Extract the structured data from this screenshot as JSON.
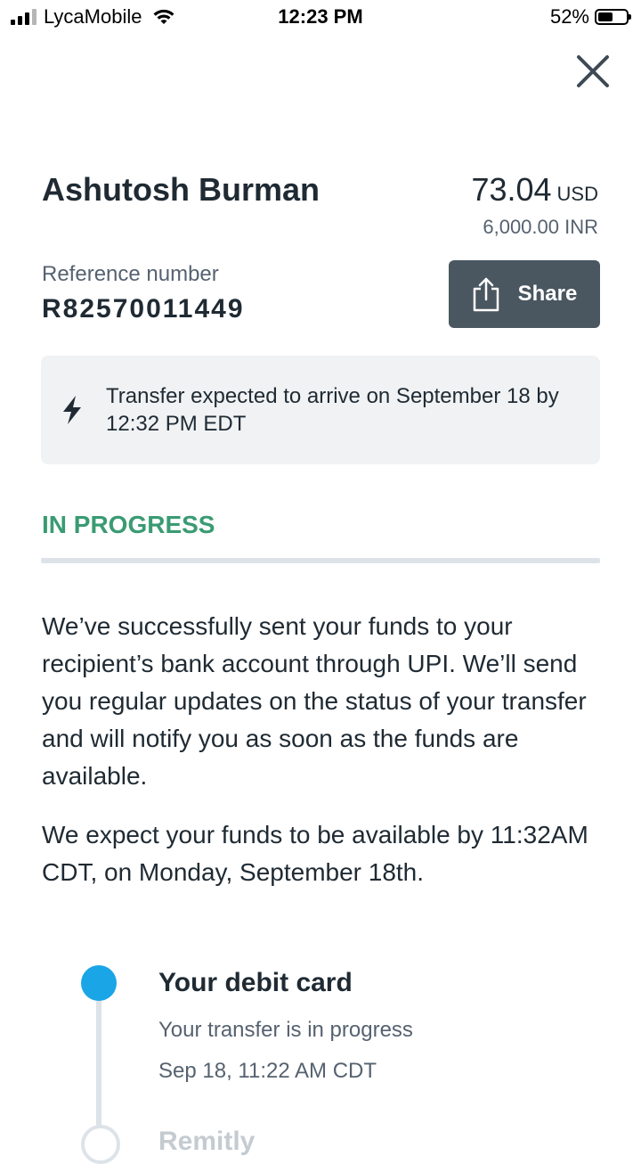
{
  "status_bar": {
    "carrier": "LycaMobile",
    "time": "12:23 PM",
    "battery": "52%",
    "battery_level": 0.52
  },
  "header": {
    "close_icon": "close-icon"
  },
  "transfer": {
    "recipient": "Ashutosh Burman",
    "amount": "73.04",
    "currency": "USD",
    "converted": "6,000.00 INR",
    "reference_label": "Reference number",
    "reference_number": "R82570011449",
    "share_label": "Share"
  },
  "eta": {
    "icon": "lightning-icon",
    "text": "Transfer expected to arrive on September 18 by 12:32 PM EDT"
  },
  "status": {
    "title": "IN PROGRESS",
    "color": "#3a9b73",
    "paragraph1": "We’ve successfully sent your funds to your recipient’s bank account through UPI. We’ll send you regular updates on the status of your transfer and will notify you as soon as the funds are available.",
    "paragraph2": "We expect your funds to be available by 11:32AM CDT, on Monday, September 18th."
  },
  "timeline": {
    "steps": [
      {
        "title": "Your debit card",
        "status": "Your transfer is in progress",
        "date": "Sep 18, 11:22 AM CDT"
      },
      {
        "title": "Remitly"
      }
    ]
  },
  "colors": {
    "accent": "#1aa5e6",
    "share_bg": "#4a5761",
    "success": "#3a9b73"
  }
}
